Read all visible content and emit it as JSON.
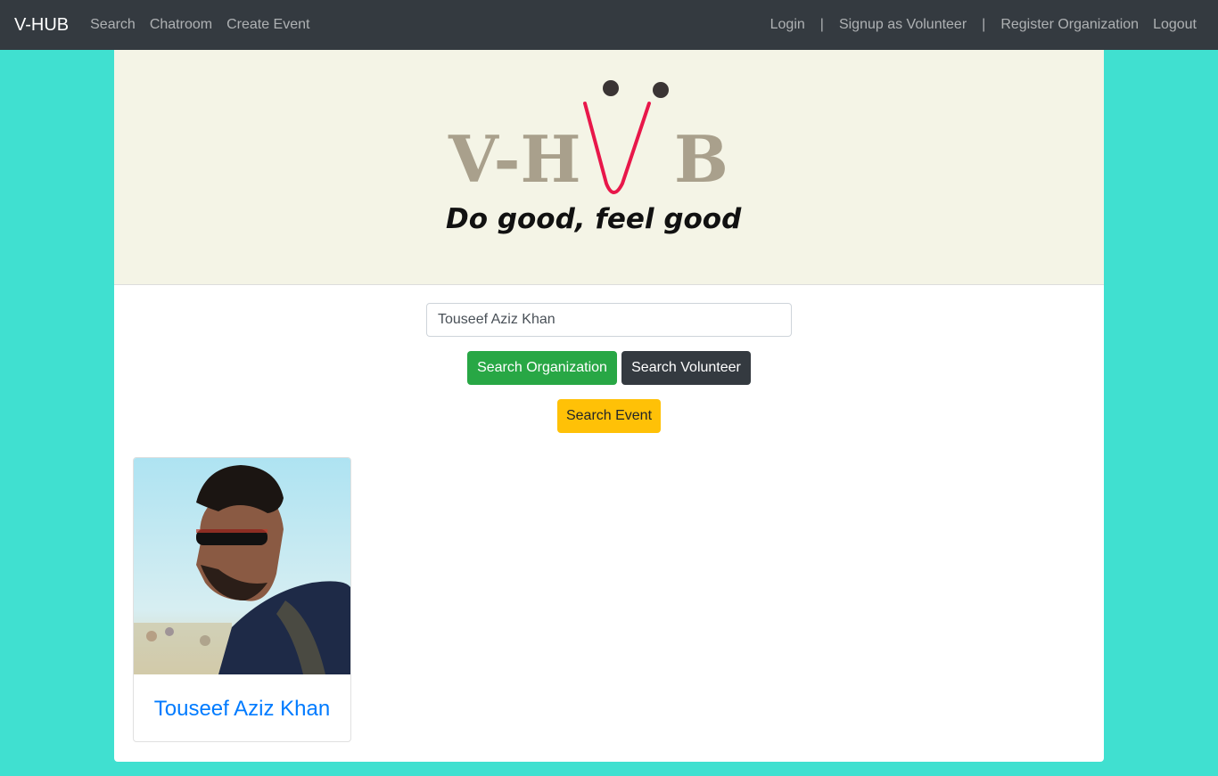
{
  "navbar": {
    "brand": "V-HUB",
    "left_links": [
      "Search",
      "Chatroom",
      "Create Event"
    ],
    "right_links": {
      "login": "Login",
      "signup": "Signup as Volunteer",
      "register": "Register Organization",
      "logout": "Logout",
      "separator": "|"
    }
  },
  "banner": {
    "logo_text": "V-HUB",
    "tagline": "Do good, feel good"
  },
  "search": {
    "value": "Touseef Aziz Khan",
    "btn_org": "Search Organization",
    "btn_vol": "Search Volunteer",
    "btn_event": "Search Event"
  },
  "results": [
    {
      "name": "Touseef Aziz Khan"
    }
  ],
  "colors": {
    "page_bg": "#40e0d0",
    "navbar": "#343a40",
    "banner_bg": "#f4f4e6",
    "org_btn": "#28a745",
    "vol_btn": "#343a40",
    "event_btn": "#ffc107",
    "link": "#007bff"
  }
}
